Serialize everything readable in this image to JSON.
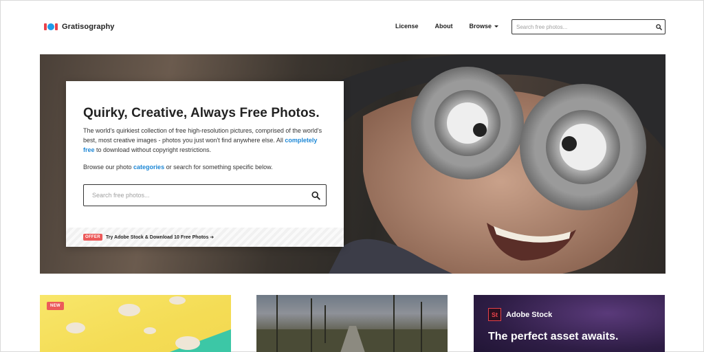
{
  "header": {
    "logo_text": "Gratisography",
    "nav": [
      {
        "label": "License"
      },
      {
        "label": "About"
      },
      {
        "label": "Browse"
      }
    ],
    "search_placeholder": "Search free photos..."
  },
  "hero": {
    "title": "Quirky, Creative, Always Free Photos.",
    "desc_part1": "The world's quirkiest collection of free high-resolution pictures, comprised of the world's best, most creative images - photos you just won't find anywhere else. All ",
    "desc_link": "completely free",
    "desc_part2": " to download without copyright restrictions.",
    "browse_part1": "Browse our photo ",
    "browse_link": "categories",
    "browse_part2": " or search for something specific below.",
    "search_placeholder": "Search free photos...",
    "offer_badge": "OFFER",
    "offer_text": "Try Adobe Stock & Download 10 Free Photos"
  },
  "thumbs": {
    "new_badge": "NEW",
    "stock_logo": "St",
    "stock_name": "Adobe Stock",
    "stock_tagline": "The perfect asset awaits."
  },
  "colors": {
    "brand_red": "#e9424a",
    "brand_blue": "#1e9be9",
    "link": "#1e88d6",
    "badge": "#ec5a5a"
  },
  "icons": {
    "header_search": "search-icon",
    "hero_search": "search-icon",
    "browse_caret": "caret-down-icon",
    "offer_arrow": "arrow-right-icon"
  }
}
